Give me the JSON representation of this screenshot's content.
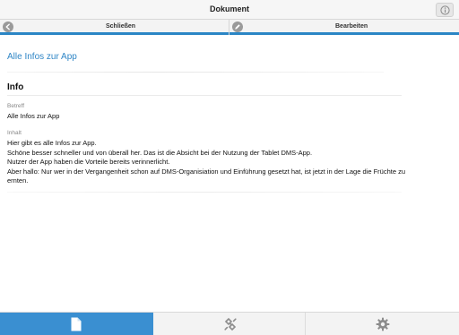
{
  "window": {
    "title": "Dokument",
    "info_icon": "info-icon"
  },
  "toolbar": {
    "close_label": "Schließen",
    "close_icon": "back-arrow-icon",
    "edit_label": "Bearbeiten",
    "edit_icon": "pencil-icon",
    "accent_color": "#2b86c5"
  },
  "document": {
    "link_title": "Alle Infos zur App",
    "section_heading": "Info",
    "fields": {
      "subject_label": "Betreff",
      "subject_value": "Alle Infos zur App",
      "content_label": "Inhalt",
      "content_lines": [
        "Hier gibt es alle Infos zur App.",
        "Schöne besser schneller und von überall her. Das ist die Absicht bei der Nutzung der Tablet DMS-App.",
        "Nutzer der App haben die Vorteile bereits verinnerlicht.",
        "Aber hallo: Nur wer in der Vergangenheit schon auf DMS-Organisiation und Einführung gesetzt hat, ist jetzt in der Lage die Früchte zu",
        "ernten."
      ]
    }
  },
  "tabbar": {
    "tabs": [
      {
        "icon": "document-icon",
        "selected": true
      },
      {
        "icon": "connection-icon",
        "selected": false
      },
      {
        "icon": "settings-gear-icon",
        "selected": false
      }
    ],
    "selected_color": "#3a8fd1"
  }
}
